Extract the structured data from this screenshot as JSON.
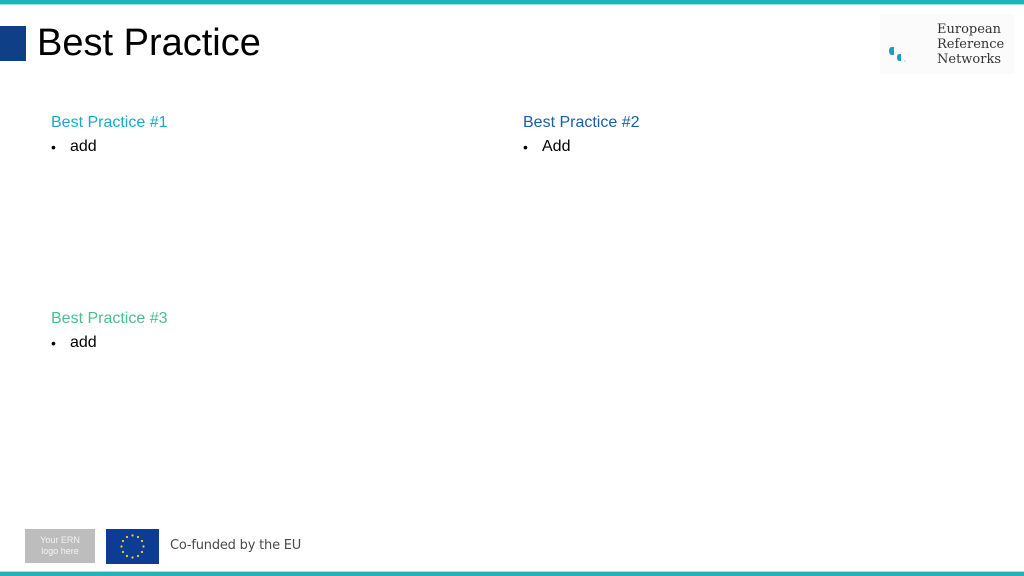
{
  "slide": {
    "title": "Best Practice",
    "header_logo": {
      "name": "ern-logo",
      "lines": [
        "European",
        "Reference",
        "Networks"
      ]
    },
    "sections": [
      {
        "heading": "Best Practice #1",
        "color": "#1ba8c9",
        "bullets": [
          "add"
        ]
      },
      {
        "heading": "Best Practice #2",
        "color": "#1a5ea8",
        "bullets": [
          "Add"
        ]
      },
      {
        "heading": "Best Practice #3",
        "color": "#4cbd8d",
        "bullets": [
          "add"
        ]
      }
    ],
    "footer": {
      "ern_logo_placeholder": [
        "Your ERN",
        "logo here"
      ],
      "eu_flag_icon": "eu-flag-icon",
      "cofunded_text": "Co-funded by the EU"
    },
    "colors": {
      "accent_bar": "#1fb5b8",
      "title_square": "#0f3f87",
      "eu_blue": "#0c3c94",
      "eu_star": "#f5d90a"
    }
  }
}
